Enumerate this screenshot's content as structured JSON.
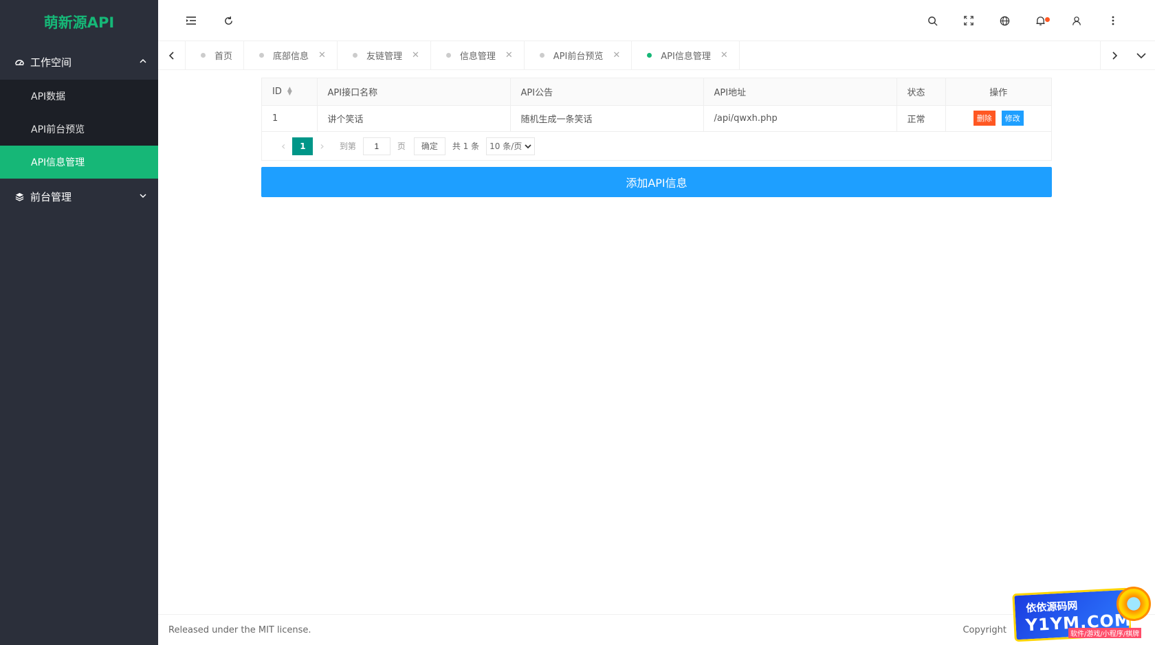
{
  "app": {
    "title": "萌新源API"
  },
  "sidebar": {
    "groups": [
      {
        "label": "工作空间",
        "icon": "dashboard-icon",
        "expanded": true,
        "items": [
          {
            "label": "API数据"
          },
          {
            "label": "API前台预览"
          },
          {
            "label": "API信息管理",
            "active": true
          }
        ]
      },
      {
        "label": "前台管理",
        "icon": "layers-icon",
        "expanded": false
      }
    ]
  },
  "header": {
    "icons": [
      "menu-toggle-icon",
      "refresh-icon",
      "search-icon",
      "fullscreen-icon",
      "globe-icon",
      "bell-icon",
      "user-icon",
      "more-icon"
    ]
  },
  "tabs": {
    "items": [
      {
        "label": "首页",
        "closable": false
      },
      {
        "label": "底部信息",
        "closable": true
      },
      {
        "label": "友链管理",
        "closable": true
      },
      {
        "label": "信息管理",
        "closable": true
      },
      {
        "label": "API前台预览",
        "closable": true
      },
      {
        "label": "API信息管理",
        "closable": true,
        "active": true
      }
    ]
  },
  "table": {
    "columns": [
      "ID",
      "API接口名称",
      "API公告",
      "API地址",
      "状态",
      "操作"
    ],
    "rows": [
      {
        "id": "1",
        "name": "讲个笑话",
        "notice": "随机生成一条笑话",
        "address": "/api/qwxh.php",
        "status": "正常"
      }
    ],
    "actions": {
      "delete": "删除",
      "edit": "修改"
    }
  },
  "pagination": {
    "current": "1",
    "goto_label": "到第",
    "input_value": "1",
    "page_label": "页",
    "confirm": "确定",
    "total": "共 1 条",
    "page_size": "10 条/页"
  },
  "add_button": {
    "label": "添加API信息"
  },
  "footer": {
    "left": "Released under the MIT license.",
    "right": "Copyright"
  },
  "watermark": {
    "line1": "依依源码网",
    "line2": "Y1YM.COM",
    "line3": "软件/游戏/小程序/棋牌"
  },
  "colors": {
    "sidebar_bg": "#2b2f3a",
    "accent_green": "#16b777",
    "primary_blue": "#1e9fff",
    "danger": "#ff5722",
    "pager_active": "#009688"
  }
}
